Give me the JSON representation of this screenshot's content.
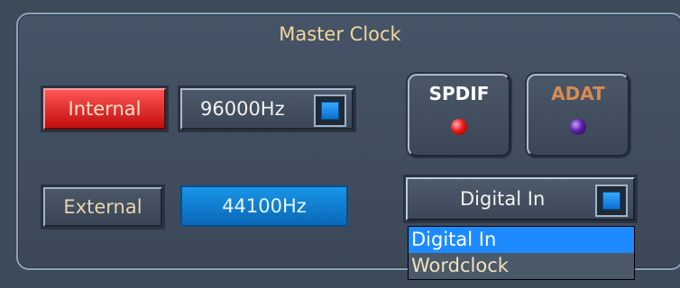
{
  "panel": {
    "title": "Master Clock"
  },
  "source_buttons": {
    "internal_label": "Internal",
    "external_label": "External",
    "selected": "Internal"
  },
  "sample_rate": {
    "internal_value": "96000Hz",
    "external_value": "44100Hz"
  },
  "status": {
    "spdif_label": "SPDIF",
    "adat_label": "ADAT"
  },
  "digital_input": {
    "selected": "Digital In",
    "options": [
      "Digital In",
      "Wordclock"
    ]
  },
  "colors": {
    "internal_active": "#e21c1c",
    "external_rate": "#0f7fd0",
    "spdif_led": "#f01818",
    "adat_led": "#5a1ca8",
    "dropdown_highlight": "#1d8bff"
  },
  "icons": {
    "rate_dropdown": "blue-square-button-icon",
    "digital_dropdown": "blue-square-button-icon",
    "spdif_led": "red-led-icon",
    "adat_led": "purple-led-icon"
  }
}
